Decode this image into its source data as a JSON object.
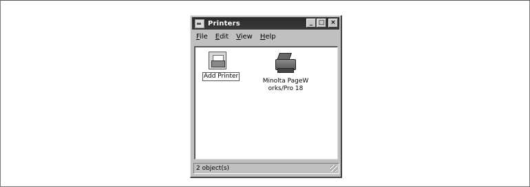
{
  "window": {
    "title": "Printers",
    "icon": "printers-folder-icon",
    "buttons": {
      "minimize": "_",
      "maximize": "□",
      "close": "×"
    }
  },
  "menu": {
    "items": [
      {
        "label": "File",
        "hotkey": "F",
        "rest": "ile"
      },
      {
        "label": "Edit",
        "hotkey": "E",
        "rest": "dit"
      },
      {
        "label": "View",
        "hotkey": "V",
        "rest": "iew"
      },
      {
        "label": "Help",
        "hotkey": "H",
        "rest": "elp"
      }
    ]
  },
  "icons": [
    {
      "label": "Add Printer",
      "icon": "add-printer-icon",
      "selected": true
    },
    {
      "label": "Minolta PageWorks/Pro 18",
      "icon": "printer-icon",
      "selected": false
    }
  ],
  "status": {
    "text": "2 object(s)"
  },
  "colors": {
    "titlebar": "#2a2a2a",
    "face": "#c0c0c0",
    "content": "#ffffff"
  }
}
